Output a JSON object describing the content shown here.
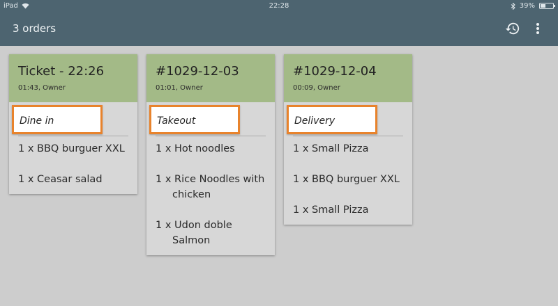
{
  "status_bar": {
    "device": "iPad",
    "time": "22:28",
    "battery": "39%",
    "battery_level": 0.39
  },
  "app_bar": {
    "title": "3 orders",
    "icons": [
      "history-icon",
      "more-vert-icon"
    ]
  },
  "colors": {
    "appbar": "#4d6470",
    "card_header": "#a3ba87",
    "highlight_border": "#e8832c",
    "background": "#cdcdcd"
  },
  "orders": [
    {
      "title": "Ticket - 22:26",
      "subtitle": "01:43, Owner",
      "type": "Dine in",
      "items": [
        "1 x BBQ burguer XXL",
        "1 x Ceasar salad"
      ]
    },
    {
      "title": "#1029-12-03",
      "subtitle": "01:01, Owner",
      "type": "Takeout",
      "items": [
        "1 x Hot noodles",
        "1 x Rice Noodles with chicken",
        "1 x Udon doble Salmon"
      ]
    },
    {
      "title": "#1029-12-04",
      "subtitle": "00:09, Owner",
      "type": "Delivery",
      "items": [
        "1 x Small Pizza",
        "1 x BBQ burguer XXL",
        "1 x Small Pizza"
      ]
    }
  ]
}
